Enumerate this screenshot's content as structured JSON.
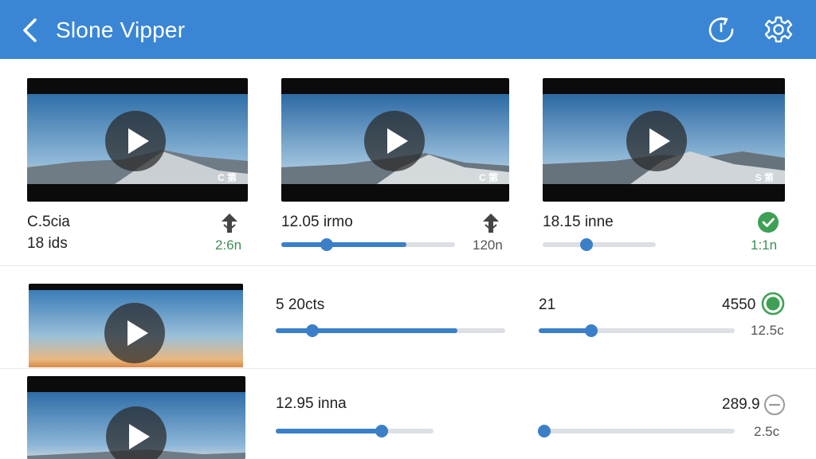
{
  "header": {
    "title": "Slone Vipper"
  },
  "colors": {
    "appbar": "#3a86d4",
    "accent": "#3b7fc9",
    "success": "#3fa055"
  },
  "icons": {
    "back": "chevron-left-icon",
    "refresh": "refresh-icon",
    "settings": "gear-icon"
  },
  "row1": [
    {
      "badge": "C 第",
      "title": "C.5cia",
      "subtitle": "18 ids",
      "meta": "2:6n",
      "status_icon": "download-icon"
    },
    {
      "badge": "C 第",
      "title": "12.05 irmo",
      "meta": "120n",
      "progress": 0.72,
      "knob": 0.26,
      "status_icon": "download-icon"
    },
    {
      "badge": "S 第",
      "title": "18.15 inne",
      "meta": "1:1n",
      "progress": 0.0,
      "knob": 0.39,
      "status_icon": "check-circle-icon"
    }
  ],
  "row2": {
    "label_a": "5 20cts",
    "progress_a": 0.79,
    "knob_a": 0.16,
    "label_b": "21",
    "value_b": "4550",
    "size_b": "12.5c",
    "progress_b": 0.27,
    "knob_b": 0.27,
    "status_icon": "radio-selected-icon"
  },
  "row3": {
    "label_a": "12.95 inna",
    "progress_a": 0.67,
    "knob_a": 0.67,
    "value_b": "289.9",
    "size_b": "2.5c",
    "progress_b": 0.0,
    "knob_b": 0.03,
    "status_icon": "minus-circle-icon"
  }
}
